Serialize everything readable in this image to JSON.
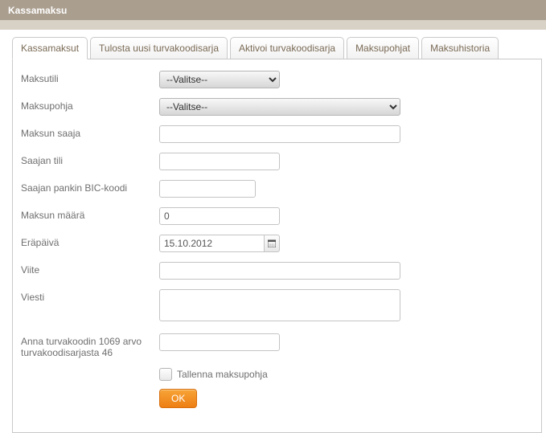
{
  "header": {
    "title": "Kassamaksu"
  },
  "tabs": {
    "t0": "Kassamaksut",
    "t1": "Tulosta uusi turvakoodisarja",
    "t2": "Aktivoi turvakoodisarja",
    "t3": "Maksupohjat",
    "t4": "Maksuhistoria"
  },
  "form": {
    "maksutili_label": "Maksutili",
    "maksutili_selected": "--Valitse--",
    "maksupohja_label": "Maksupohja",
    "maksupohja_selected": "--Valitse--",
    "maksun_saaja_label": "Maksun saaja",
    "maksun_saaja_value": "",
    "saajan_tili_label": "Saajan tili",
    "saajan_tili_value": "",
    "bic_label": "Saajan pankin BIC-koodi",
    "bic_value": "",
    "maksun_maara_label": "Maksun määrä",
    "maksun_maara_value": "0",
    "erapaiva_label": "Eräpäivä",
    "erapaiva_value": "15.10.2012",
    "viite_label": "Viite",
    "viite_value": "",
    "viesti_label": "Viesti",
    "viesti_value": "",
    "turvakoodi_label": "Anna turvakoodin 1069 arvo turvakoodisarjasta 46",
    "turvakoodi_value": "",
    "tallenna_label": "Tallenna maksupohja",
    "ok_label": "OK"
  }
}
